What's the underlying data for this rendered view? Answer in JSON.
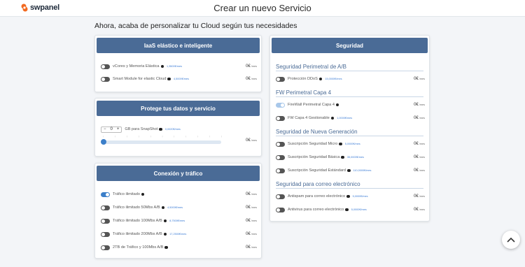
{
  "brand": {
    "logo_text": "swpanel"
  },
  "page_title": "Crear un nuevo Servicio",
  "heading": "Ahora, acaba de personalizar tu Cloud según tus necesidades",
  "currency_suffix": "/mes",
  "iaas": {
    "title": "IaaS elástico e inteligente",
    "rows": [
      {
        "label": "vCores y Memoria Elástica",
        "link": "1,3500€/mes",
        "price": "0€",
        "on": false
      },
      {
        "label": "Smart Module for elastic Cloud",
        "link": "4,5000€/mes",
        "price": "0€",
        "on": false
      }
    ]
  },
  "backup": {
    "title": "Protege tus datos y servicio",
    "stepper_minus": "−",
    "stepper_value": "0",
    "stepper_plus": "+",
    "label": "GB para SnapShot",
    "link": "0,0020€/mes",
    "price": "0€",
    "slider_value": 0
  },
  "connection": {
    "title": "Conexión y tráfico",
    "rows": [
      {
        "label": "Tráfico ilimitado",
        "link": "",
        "price": "0€",
        "on": true
      },
      {
        "label": "Tráfico ilimitado 50Mbs A/B",
        "link": "4,5000€/mes",
        "price": "0€",
        "on": false
      },
      {
        "label": "Tráfico ilimitado 100Mbs A/B",
        "link": "8,7500€/mes",
        "price": "0€",
        "on": false
      },
      {
        "label": "Tráfico ilimitado 200Mbs A/B",
        "link": "17,2500€/mes",
        "price": "0€",
        "on": false
      },
      {
        "label": "2TB de Tráfico y 100Mbs A/B",
        "link": "",
        "price": "0€",
        "on": false
      }
    ]
  },
  "security": {
    "title": "Seguridad",
    "sections": [
      {
        "title": "Seguridad Perimetral de A/B",
        "rows": [
          {
            "label": "Protección DDoS",
            "link": "15,0000€/mes",
            "price": "0€",
            "on": false
          }
        ]
      },
      {
        "title": "FW Perimetral Capa 4",
        "rows": [
          {
            "label": "FireWall Perimetral Capa 4",
            "link": "",
            "price": "0€",
            "on": true
          },
          {
            "label": "FW Capa 4 Gestionable",
            "link": "1,0000€/mes",
            "price": "0€",
            "on": false
          }
        ]
      },
      {
        "title": "Seguridad de Nueva Generación",
        "rows": [
          {
            "label": "Suscripción Seguridad Micro",
            "link": "5,0000€/mes",
            "price": "0€",
            "on": false
          },
          {
            "label": "Suscripción Seguridad Básica",
            "link": "35,0000€/mes",
            "price": "0€",
            "on": false
          },
          {
            "label": "Suscripción Seguridad Estándard",
            "link": "110,0000€/mes",
            "price": "0€",
            "on": false
          }
        ]
      },
      {
        "title": "Seguridad para correo electrónico",
        "rows": [
          {
            "label": "Antispam para correo electrónico",
            "link": "5,0000€/mes",
            "price": "0€",
            "on": false
          },
          {
            "label": "Antivirus para correo electrónico",
            "link": "5,0000€/mes",
            "price": "0€",
            "on": false
          }
        ]
      }
    ]
  },
  "icons": {
    "scroll_top": "chevron-up-icon",
    "info": "info-icon"
  },
  "colors": {
    "card_header": "#4a6b96",
    "toggle_on": "#3c7fc9",
    "brand_orange": "#f26a21",
    "link": "#3a7bd5"
  }
}
